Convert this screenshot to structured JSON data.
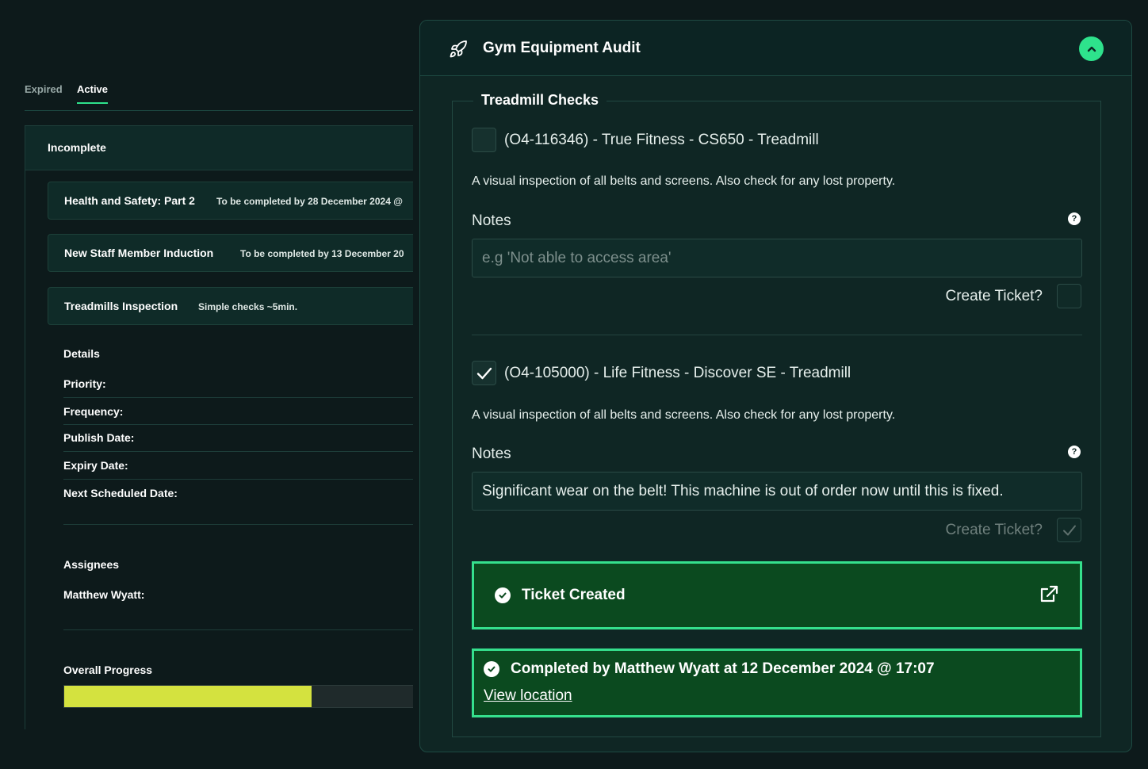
{
  "tabs": {
    "expired": "Expired",
    "active": "Active"
  },
  "section_header": "Incomplete",
  "tasks": [
    {
      "title": "Health and Safety: Part 2",
      "subtitle": "To be completed by 28 December 2024 @"
    },
    {
      "title": "New Staff Member Induction",
      "subtitle": "To be completed by 13 December 20"
    },
    {
      "title": "Treadmills Inspection",
      "subtitle": "Simple checks ~5min."
    }
  ],
  "details": {
    "heading": "Details",
    "priority": "Priority:",
    "frequency": "Frequency:",
    "publish_date": "Publish Date:",
    "expiry_date": "Expiry Date:",
    "next_scheduled": "Next Scheduled Date:"
  },
  "assignees": {
    "heading": "Assignees",
    "person": "Matthew Wyatt:"
  },
  "progress": {
    "label": "Overall Progress",
    "value": 0.71,
    "color": "#d4e23f"
  },
  "modal": {
    "title": "Gym Equipment Audit",
    "section_title": "Treadmill Checks",
    "items": [
      {
        "title": "(O4-116346) - True Fitness - CS650 - Treadmill",
        "checked": false,
        "description": "A visual inspection of all belts and screens. Also check for any lost property.",
        "notes_label": "Notes",
        "notes_placeholder": "e.g 'Not able to access area'",
        "notes_value": "",
        "create_ticket_label": "Create Ticket?",
        "create_ticket_checked": false
      },
      {
        "title": "(O4-105000) - Life Fitness - Discover SE - Treadmill",
        "checked": true,
        "description": "A visual inspection of all belts and screens. Also check for any lost property.",
        "notes_label": "Notes",
        "notes_value": "Significant wear on the belt! This machine is out of order now until this is fixed.",
        "create_ticket_label": "Create Ticket?",
        "create_ticket_checked": true
      }
    ],
    "ticket_created": "Ticket Created",
    "completed_by": "Completed by Matthew Wyatt at 12 December 2024 @ 17:07",
    "view_location": "View location"
  },
  "colors": {
    "accent": "#2ee28c",
    "success_bg": "#0b4a1f",
    "success_border": "#35e08d",
    "background": "#0d1a1b"
  },
  "icons": [
    "rocket-icon",
    "chevron-up-icon",
    "help-icon",
    "checkmark-icon",
    "check-circle-icon",
    "external-link-icon"
  ]
}
